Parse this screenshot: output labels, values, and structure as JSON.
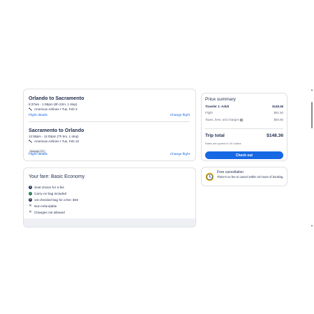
{
  "legs": [
    {
      "title": "Orlando to Sacramento",
      "time": "8:37am - 1:59pm (8h 22m, 1 stop)",
      "airline": "American Airlines • Tue, Feb 3",
      "details_link": "Flight details",
      "change_link": "Change flight"
    },
    {
      "title": "Sacramento to Orlando",
      "time": "12:58pm - 11:03pm (7h 5m, 1 stop)",
      "airline": "American Airlines • Tue, Feb 10",
      "badge": "Average CO₂",
      "details_link": "Flight details",
      "change_link": "Change flight"
    }
  ],
  "fare": {
    "title": "Your fare: Basic Economy",
    "items": [
      {
        "icon": "dollar-icon",
        "label": "Seat choice for a fee"
      },
      {
        "icon": "check-icon",
        "label": "Carry-on bag included"
      },
      {
        "icon": "dollar-icon",
        "label": "1st checked bag for a fee: $40"
      },
      {
        "icon": "x-icon",
        "label": "Non-refundable"
      },
      {
        "icon": "x-icon",
        "label": "Changes not allowed"
      }
    ]
  },
  "price_summary": {
    "title": "Price summary",
    "traveler_label": "Traveler 1: Adult",
    "traveler_total": "$148.36",
    "flight_label": "Flight",
    "flight_value": "$91.50",
    "taxes_label": "Taxes, fees, and charges",
    "taxes_value": "$56.86",
    "trip_total_label": "Trip total",
    "trip_total_value": "$148.36",
    "currency_note": "Rates are quoted in US dollars",
    "checkout_label": "Check out"
  },
  "cancellation": {
    "title": "Free cancellation",
    "text": "There's no fee to cancel within 24 hours of booking."
  },
  "colors": {
    "primary": "#1668e3",
    "text": "#1f2b4d",
    "check": "#227950",
    "clock_yellow": "#f5c518"
  }
}
